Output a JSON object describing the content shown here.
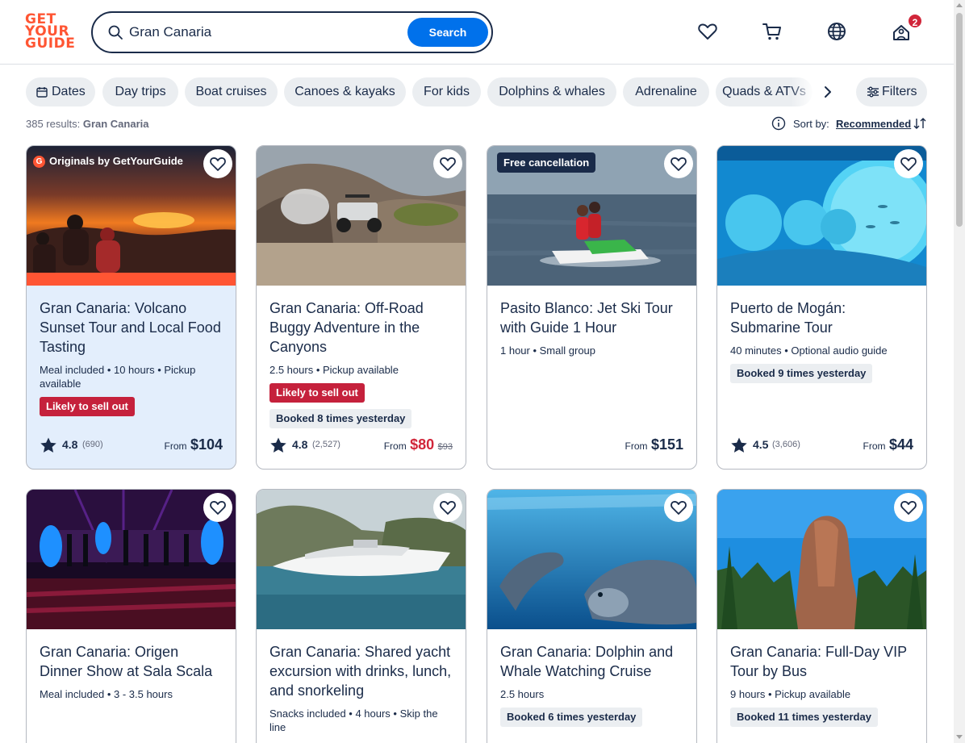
{
  "header": {
    "logo_lines": [
      "GET",
      "YOUR",
      "GUIDE"
    ],
    "search_value": "Gran Canaria",
    "search_button": "Search",
    "icons": [
      "heart-icon",
      "cart-icon",
      "globe-icon",
      "profile-icon"
    ],
    "notification_count": "2"
  },
  "filters": {
    "chips": [
      "Dates",
      "Day trips",
      "Boat cruises",
      "Canoes & kayaks",
      "For kids",
      "Dolphins & whales",
      "Adrenaline",
      "Quads & ATVs"
    ],
    "filters_label": "Filters"
  },
  "results": {
    "count_text": "385 results: ",
    "query": "Gran Canaria",
    "sort_label": "Sort by:",
    "sort_value": "Recommended"
  },
  "cards": [
    {
      "badge": "Originals by GetYourGuide",
      "title": "Gran Canaria: Volcano Sunset Tour and Local Food Tasting",
      "meta": "Meal included • 10 hours • Pickup available",
      "tag_red": "Likely to sell out",
      "rating": "4.8",
      "reviews": "(690)",
      "from": "From",
      "price": "$104"
    },
    {
      "title": "Gran Canaria: Off-Road Buggy Adventure in the Canyons",
      "meta": "2.5 hours • Pickup available",
      "tag_red": "Likely to sell out",
      "tag_gray": "Booked 8 times yesterday",
      "rating": "4.8",
      "reviews": "(2,527)",
      "from": "From",
      "price": "$80",
      "old_price": "$93"
    },
    {
      "badge": "Free cancellation",
      "title": "Pasito Blanco: Jet Ski Tour with Guide 1 Hour",
      "meta": "1 hour • Small group",
      "from": "From",
      "price": "$151"
    },
    {
      "title": "Puerto de Mogán: Submarine Tour",
      "meta": "40 minutes • Optional audio guide",
      "tag_gray": "Booked 9 times yesterday",
      "rating": "4.5",
      "reviews": "(3,606)",
      "from": "From",
      "price": "$44"
    },
    {
      "title": "Gran Canaria: Origen Dinner Show at Sala Scala",
      "meta": "Meal included • 3 - 3.5 hours"
    },
    {
      "title": "Gran Canaria: Shared yacht excursion with drinks, lunch, and snorkeling",
      "meta": "Snacks included • 4 hours • Skip the line"
    },
    {
      "title": "Gran Canaria: Dolphin and Whale Watching Cruise",
      "meta": "2.5 hours",
      "tag_gray": "Booked 6 times yesterday"
    },
    {
      "title": "Gran Canaria: Full-Day VIP Tour by Bus",
      "meta": "9 hours • Pickup available",
      "tag_gray": "Booked 11 times yesterday"
    }
  ],
  "colors": {
    "brand": "#ff5533",
    "primary": "#0071eb",
    "text": "#1a2b49",
    "sale_red": "#d1263a",
    "chip_bg": "#ebeef1",
    "originals_bg": "#e3eefc"
  }
}
